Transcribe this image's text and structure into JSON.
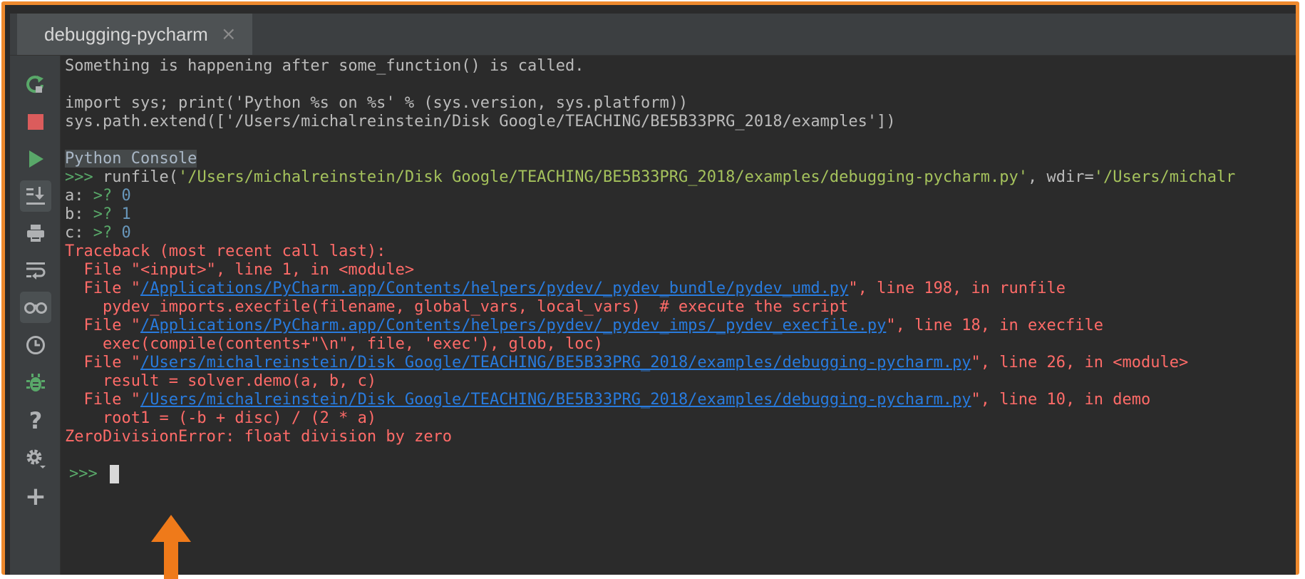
{
  "tab": {
    "title": "debugging-pycharm",
    "close_glyph": "×"
  },
  "toolbar": {
    "buttons": [
      {
        "name": "rerun-icon",
        "color": "#59a869"
      },
      {
        "name": "stop-icon",
        "color": "#db5c5c"
      },
      {
        "name": "run-icon",
        "color": "#59a869"
      },
      {
        "name": "scroll-to-end-icon",
        "color": "#afb1b3"
      },
      {
        "name": "print-icon",
        "color": "#afb1b3"
      },
      {
        "name": "soft-wrap-icon",
        "color": "#afb1b3"
      },
      {
        "name": "show-variables-icon",
        "color": "#afb1b3"
      },
      {
        "name": "history-icon",
        "color": "#afb1b3"
      },
      {
        "name": "debug-icon",
        "color": "#59a869"
      },
      {
        "name": "help-icon",
        "color": "#afb1b3"
      },
      {
        "name": "settings-icon",
        "color": "#afb1b3"
      },
      {
        "name": "add-icon",
        "color": "#afb1b3"
      }
    ],
    "help_glyph": "?",
    "add_glyph": "+"
  },
  "console": {
    "line1": "Something is happening after some_function() is called.",
    "line2": "import sys; print('Python %s on %s' % (sys.version, sys.platform))",
    "line3": "sys.path.extend(['/Users/michalreinstein/Disk Google/TEACHING/BE5B33PRG_2018/examples'])",
    "console_label": "Python Console",
    "prompt": ">>>",
    "runfile_prefix": " runfile(",
    "runfile_arg": "'/Users/michalreinstein/Disk Google/TEACHING/BE5B33PRG_2018/examples/debugging-pycharm.py'",
    "runfile_sep": ", wdir=",
    "runfile_wdir": "'/Users/michalr",
    "inputs": [
      {
        "label": "a: ",
        "prompt": ">? ",
        "value": "0"
      },
      {
        "label": "b: ",
        "prompt": ">? ",
        "value": "1"
      },
      {
        "label": "c: ",
        "prompt": ">? ",
        "value": "0"
      }
    ],
    "traceback_head": "Traceback (most recent call last):",
    "tb_input": "  File \"<input>\", line 1, in <module>",
    "file_prefix": "  File \"",
    "frames": [
      {
        "path": "/Applications/PyCharm.app/Contents/helpers/pydev/_pydev_bundle/pydev_umd.py",
        "suffix": "\", line 198, in runfile",
        "code": "    pydev_imports.execfile(filename, global_vars, local_vars)  # execute the script"
      },
      {
        "path": "/Applications/PyCharm.app/Contents/helpers/pydev/_pydev_imps/_pydev_execfile.py",
        "suffix": "\", line 18, in execfile",
        "code": "    exec(compile(contents+\"\\n\", file, 'exec'), glob, loc)"
      },
      {
        "path": "/Users/michalreinstein/Disk Google/TEACHING/BE5B33PRG_2018/examples/debugging-pycharm.py",
        "suffix": "\", line 26, in <module>",
        "code": "    result = solver.demo(a, b, c)"
      },
      {
        "path": "/Users/michalreinstein/Disk Google/TEACHING/BE5B33PRG_2018/examples/debugging-pycharm.py",
        "suffix": "\", line 10, in demo",
        "code": "    root1 = (-b + disc) / (2 * a)"
      }
    ],
    "error": "ZeroDivisionError: float division by zero",
    "final_prompt": ">>> "
  },
  "colors": {
    "accent_frame": "#ef8a2e",
    "error": "#ff6b68",
    "link": "#287bde",
    "prompt": "#59a869"
  }
}
